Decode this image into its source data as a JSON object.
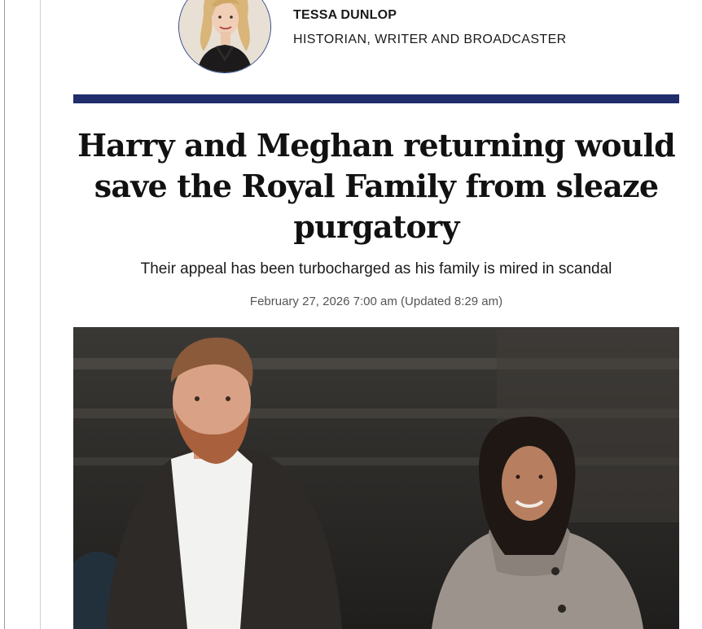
{
  "author": {
    "name": "TESSA DUNLOP",
    "role": "HISTORIAN, WRITER AND BROADCASTER"
  },
  "article": {
    "headline": "Harry and Meghan returning would save the Royal Family from sleaze purgatory",
    "standfirst": "Their appeal has been turbocharged as his family is mired in scandal",
    "dateline": "February 27, 2026 7:00 am (Updated 8:29 am)"
  },
  "colors": {
    "accent_bar": "#1f2d6b",
    "avatar_border": "#2d4a8a",
    "headline": "#111111",
    "dateline": "#555555"
  }
}
